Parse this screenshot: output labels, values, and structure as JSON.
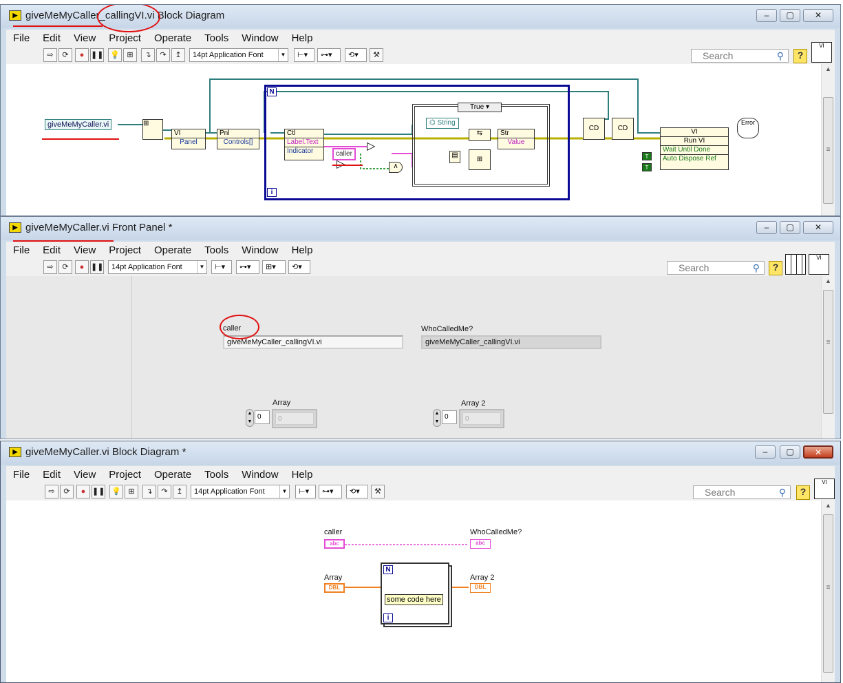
{
  "colors": {
    "titlebar": "#c7d6e8",
    "string_wire": "#e44ad6",
    "refnum_wire": "#2e7d7d",
    "error_wire": "#b8b000",
    "dbl_wire": "#f08020",
    "annotation": "#e01010"
  },
  "menu": [
    "File",
    "Edit",
    "View",
    "Project",
    "Operate",
    "Tools",
    "Window",
    "Help"
  ],
  "toolbar": {
    "font": "14pt Application Font",
    "search_placeholder": "Search",
    "help": "?"
  },
  "win1": {
    "title": "giveMeMyCaller_callingVI.vi Block Diagram",
    "vi_ref": "giveMeMyCaller.vi",
    "nodes": {
      "vi_prop": "VI",
      "panel": "Panel",
      "pnl": "Pnl",
      "controls": "Controls[]",
      "ctl": "Ctl",
      "label_text": "Label.Text",
      "indicator": "Indicator",
      "caller": "caller",
      "case_sel": "True",
      "string": "String",
      "str": "Str",
      "value": "Value",
      "run_vi": "VI",
      "run_vi_m": "Run VI",
      "wait": "Wait Until Done",
      "auto": "Auto Dispose Ref",
      "error": "Error"
    },
    "loop_n": "N",
    "loop_i": "i"
  },
  "win2": {
    "title": "giveMeMyCaller.vi Front Panel *",
    "caller_label": "caller",
    "caller_value": "giveMeMyCaller_callingVI.vi",
    "who_label": "WhoCalledMe?",
    "who_value": "giveMeMyCaller_callingVI.vi",
    "array_label": "Array",
    "array_index": "0",
    "array_elem": "0",
    "array2_label": "Array 2",
    "array2_index": "0",
    "array2_elem": "0"
  },
  "win3": {
    "title": "giveMeMyCaller.vi Block Diagram *",
    "caller_label": "caller",
    "caller_term": "abc",
    "who_label": "WhoCalledMe?",
    "who_term": "abc",
    "array_label": "Array",
    "array_term": "DBL",
    "array2_label": "Array 2",
    "array2_term": "DBL",
    "loop_n": "N",
    "loop_i": "i",
    "comment": "some code here"
  }
}
